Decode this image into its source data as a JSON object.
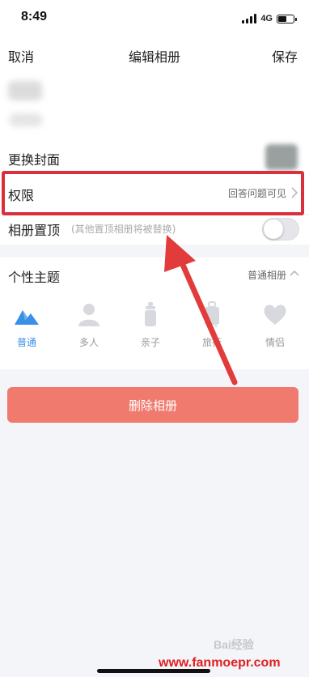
{
  "status_bar": {
    "time": "8:49",
    "network": "4G",
    "signal_bars_filled": 4,
    "battery_level": 0.55
  },
  "nav": {
    "cancel_label": "取消",
    "title": "编辑相册",
    "save_label": "保存"
  },
  "settings": {
    "change_cover_label": "更换封面",
    "permission_label": "权限",
    "permission_value": "回答问题可见",
    "pin_label": "相册置顶",
    "pin_note": "(其他置顶相册将被替换)",
    "pin_enabled": false
  },
  "theme": {
    "title": "个性主题",
    "current_value": "普通相册",
    "items": [
      {
        "label": "普通",
        "icon": "mountain-icon",
        "active": true
      },
      {
        "label": "多人",
        "icon": "person-icon",
        "active": false
      },
      {
        "label": "亲子",
        "icon": "baby-bottle-icon",
        "active": false
      },
      {
        "label": "旅行",
        "icon": "luggage-icon",
        "active": false
      },
      {
        "label": "情侣",
        "icon": "heart-icon",
        "active": false
      }
    ]
  },
  "delete_button_label": "删除相册",
  "watermark": {
    "baidu": "Bai经验",
    "url": "www.fanmoepr.com"
  },
  "colors": {
    "highlight": "#d9303c",
    "delete_button": "#f07a6e",
    "active_theme": "#3a8fe8",
    "inactive_icon": "#d8d9de"
  }
}
